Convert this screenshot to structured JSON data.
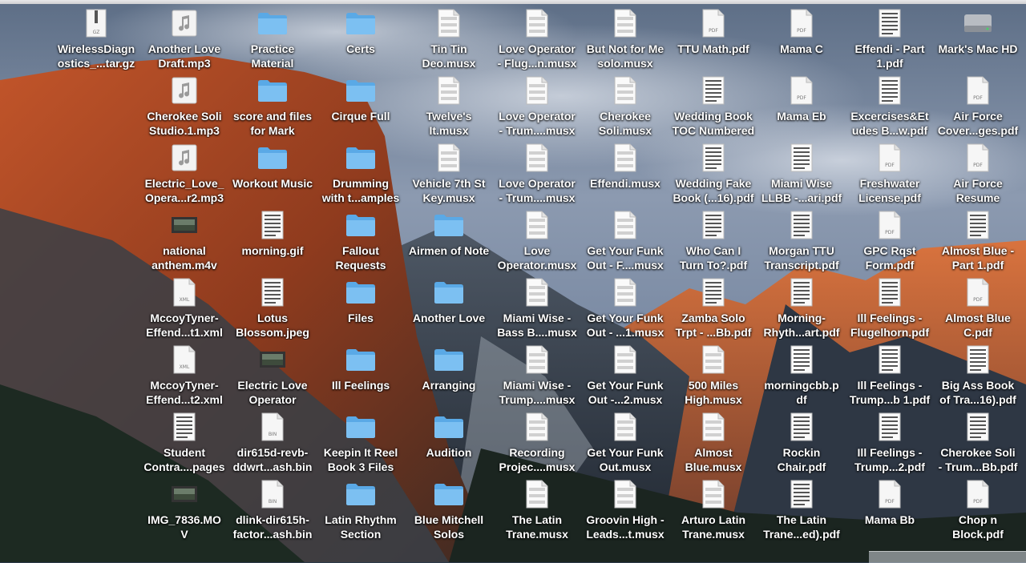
{
  "columns": [
    [
      {
        "name": "WirelessDiagn\nostics_...tar.gz",
        "icon": "archive-icon",
        "kind": "archive",
        "badge": "GZ"
      },
      {
        "name": "",
        "icon": "none",
        "kind": "blank"
      },
      {
        "name": "",
        "icon": "none",
        "kind": "blank"
      },
      {
        "name": "",
        "icon": "none",
        "kind": "blank"
      },
      {
        "name": "",
        "icon": "none",
        "kind": "blank"
      },
      {
        "name": "",
        "icon": "none",
        "kind": "blank"
      },
      {
        "name": "",
        "icon": "none",
        "kind": "blank"
      },
      {
        "name": "",
        "icon": "none",
        "kind": "blank"
      }
    ],
    [
      {
        "name": "Another Love\nDraft.mp3",
        "icon": "audio-file-icon",
        "kind": "audio"
      },
      {
        "name": "Cherokee Soli\nStudio.1.mp3",
        "icon": "audio-file-icon",
        "kind": "audio"
      },
      {
        "name": "Electric_Love_\nOpera...r2.mp3",
        "icon": "audio-file-icon",
        "kind": "audio"
      },
      {
        "name": "national\nanthem.m4v",
        "icon": "video-file-icon",
        "kind": "video"
      },
      {
        "name": "McсoyTyner-\nEffend...t1.xml",
        "icon": "xml-file-icon",
        "kind": "doc",
        "badge": "XML"
      },
      {
        "name": "MccoyTyner-\nEffend...t2.xml",
        "icon": "xml-file-icon",
        "kind": "doc",
        "badge": "XML"
      },
      {
        "name": "Student\nContra....pages",
        "icon": "pages-document-icon",
        "kind": "sheet"
      },
      {
        "name": "IMG_7836.MO\nV",
        "icon": "video-file-icon",
        "kind": "video"
      }
    ],
    [
      {
        "name": "Practice\nMaterial",
        "icon": "folder-icon",
        "kind": "folder"
      },
      {
        "name": "score and files\nfor Mark",
        "icon": "folder-icon",
        "kind": "folder"
      },
      {
        "name": "Workout Music",
        "icon": "folder-icon",
        "kind": "folder"
      },
      {
        "name": "morning.gif",
        "icon": "image-file-icon",
        "kind": "sheet"
      },
      {
        "name": "Lotus\nBlossom.jpeg",
        "icon": "image-file-icon",
        "kind": "sheet"
      },
      {
        "name": "Electric Love\nOperator",
        "icon": "application-icon",
        "kind": "video"
      },
      {
        "name": "dir615d-revb-\nddwrt...ash.bin",
        "icon": "binary-file-icon",
        "kind": "doc",
        "badge": "BIN"
      },
      {
        "name": "dlink-dir615h-\nfactor...ash.bin",
        "icon": "binary-file-icon",
        "kind": "doc",
        "badge": "BIN"
      }
    ],
    [
      {
        "name": "Certs",
        "icon": "folder-icon",
        "kind": "folder"
      },
      {
        "name": "Cirque Full",
        "icon": "folder-icon",
        "kind": "folder"
      },
      {
        "name": "Drumming\nwith t...amples",
        "icon": "folder-icon",
        "kind": "folder"
      },
      {
        "name": "Fallout\nRequests",
        "icon": "folder-icon",
        "kind": "folder"
      },
      {
        "name": "Files",
        "icon": "folder-icon",
        "kind": "folder"
      },
      {
        "name": "Ill Feelings",
        "icon": "folder-icon",
        "kind": "folder"
      },
      {
        "name": "Keepin It Reel\nBook 3 Files",
        "icon": "folder-icon",
        "kind": "folder"
      },
      {
        "name": "Latin Rhythm\nSection",
        "icon": "folder-icon",
        "kind": "folder"
      }
    ],
    [
      {
        "name": "Tin Tin\nDeo.musx",
        "icon": "music-score-icon",
        "kind": "score"
      },
      {
        "name": "Twelve's\nIt.musx",
        "icon": "music-score-icon",
        "kind": "score"
      },
      {
        "name": "Vehicle 7th St\nKey.musx",
        "icon": "music-score-icon",
        "kind": "score"
      },
      {
        "name": "Airmen of Note",
        "icon": "folder-icon",
        "kind": "folder"
      },
      {
        "name": "Another Love",
        "icon": "folder-icon",
        "kind": "folder"
      },
      {
        "name": "Arranging",
        "icon": "folder-icon",
        "kind": "folder"
      },
      {
        "name": "Audition",
        "icon": "folder-icon",
        "kind": "folder"
      },
      {
        "name": "Blue Mitchell\nSolos",
        "icon": "folder-icon",
        "kind": "folder"
      }
    ],
    [
      {
        "name": "Love Operator\n- Flug...n.musx",
        "icon": "music-score-icon",
        "kind": "score"
      },
      {
        "name": "Love Operator\n- Trum....musx",
        "icon": "music-score-icon",
        "kind": "score"
      },
      {
        "name": "Love Operator\n- Trum....musx",
        "icon": "music-score-icon",
        "kind": "score"
      },
      {
        "name": "Love\nOperator.musx",
        "icon": "music-score-icon",
        "kind": "score"
      },
      {
        "name": "Miami Wise -\nBass B....musx",
        "icon": "music-score-icon",
        "kind": "score"
      },
      {
        "name": "Miami Wise -\nTrump....musx",
        "icon": "music-score-icon",
        "kind": "score"
      },
      {
        "name": "Recording\nProjec....musx",
        "icon": "music-score-icon",
        "kind": "score"
      },
      {
        "name": "The Latin\nTrane.musx",
        "icon": "music-score-icon",
        "kind": "score"
      }
    ],
    [
      {
        "name": "But Not for Me\nsolo.musx",
        "icon": "music-score-icon",
        "kind": "score"
      },
      {
        "name": "Cherokee\nSoli.musx",
        "icon": "music-score-icon",
        "kind": "score"
      },
      {
        "name": "Effendi.musx",
        "icon": "music-score-icon",
        "kind": "score"
      },
      {
        "name": "Get Your Funk\nOut - F....musx",
        "icon": "music-score-icon",
        "kind": "score"
      },
      {
        "name": "Get Your Funk\nOut - ...1.musx",
        "icon": "music-score-icon",
        "kind": "score"
      },
      {
        "name": "Get Your Funk\nOut -...2.musx",
        "icon": "music-score-icon",
        "kind": "score"
      },
      {
        "name": "Get Your Funk\nOut.musx",
        "icon": "music-score-icon",
        "kind": "score"
      },
      {
        "name": "Groovin High -\nLeads...t.musx",
        "icon": "music-score-icon",
        "kind": "score"
      }
    ],
    [
      {
        "name": "TTU Math.pdf",
        "icon": "pdf-file-icon",
        "kind": "pdf",
        "badge": "PDF"
      },
      {
        "name": "Wedding Book\nTOC Numbered",
        "icon": "document-icon",
        "kind": "sheet"
      },
      {
        "name": "Wedding Fake\nBook (...16).pdf",
        "icon": "pdf-file-icon",
        "kind": "sheet"
      },
      {
        "name": "Who Can I\nTurn To?.pdf",
        "icon": "pdf-file-icon",
        "kind": "sheet"
      },
      {
        "name": "Zamba Solo\nTrpt - ...Bb.pdf",
        "icon": "pdf-file-icon",
        "kind": "sheet"
      },
      {
        "name": "500 Miles\nHigh.musx",
        "icon": "music-score-icon",
        "kind": "score"
      },
      {
        "name": "Almost\nBlue.musx",
        "icon": "music-score-icon",
        "kind": "score"
      },
      {
        "name": "Arturo Latin\nTrane.musx",
        "icon": "music-score-icon",
        "kind": "score"
      }
    ],
    [
      {
        "name": "Mama C",
        "icon": "pdf-file-icon",
        "kind": "pdf",
        "badge": "PDF"
      },
      {
        "name": "Mama Eb",
        "icon": "pdf-file-icon",
        "kind": "pdf",
        "badge": "PDF"
      },
      {
        "name": "Miami Wise\nLLBB -...ari.pdf",
        "icon": "pdf-file-icon",
        "kind": "sheet"
      },
      {
        "name": "Morgan TTU\nTranscript.pdf",
        "icon": "pdf-file-icon",
        "kind": "sheet"
      },
      {
        "name": "Morning-\nRhyth...art.pdf",
        "icon": "pdf-file-icon",
        "kind": "sheet"
      },
      {
        "name": "morningcbb.p\ndf",
        "icon": "pdf-file-icon",
        "kind": "sheet"
      },
      {
        "name": "Rockin\nChair.pdf",
        "icon": "pdf-file-icon",
        "kind": "sheet"
      },
      {
        "name": "The Latin\nTrane...ed).pdf",
        "icon": "pdf-file-icon",
        "kind": "sheet"
      }
    ],
    [
      {
        "name": "Effendi - Part\n1.pdf",
        "icon": "pdf-file-icon",
        "kind": "sheet"
      },
      {
        "name": "Excercises&Et\nudes B...w.pdf",
        "icon": "pdf-file-icon",
        "kind": "sheet"
      },
      {
        "name": "Freshwater\nLicense.pdf",
        "icon": "pdf-file-icon",
        "kind": "pdf",
        "badge": "PDF"
      },
      {
        "name": "GPC Rqst\nForm.pdf",
        "icon": "pdf-file-icon",
        "kind": "pdf",
        "badge": "PDF"
      },
      {
        "name": "Ill Feelings -\nFlugelhorn.pdf",
        "icon": "pdf-file-icon",
        "kind": "sheet"
      },
      {
        "name": "Ill Feelings -\nTrump...b 1.pdf",
        "icon": "pdf-file-icon",
        "kind": "sheet"
      },
      {
        "name": "Ill Feelings -\nTrump...2.pdf",
        "icon": "pdf-file-icon",
        "kind": "sheet"
      },
      {
        "name": "Mama Bb",
        "icon": "pdf-file-icon",
        "kind": "pdf",
        "badge": "PDF"
      }
    ],
    [
      {
        "name": "Mark's Mac HD",
        "icon": "hard-drive-icon",
        "kind": "drive"
      },
      {
        "name": "Air Force\nCover...ges.pdf",
        "icon": "pdf-file-icon",
        "kind": "pdf",
        "badge": "PDF"
      },
      {
        "name": "Air Force\nResume",
        "icon": "pdf-file-icon",
        "kind": "pdf",
        "badge": "PDF"
      },
      {
        "name": "Almost Blue -\nPart 1.pdf",
        "icon": "pdf-file-icon",
        "kind": "sheet"
      },
      {
        "name": "Almost Blue\nC.pdf",
        "icon": "pdf-file-icon",
        "kind": "pdf",
        "badge": "PDF"
      },
      {
        "name": "Big Ass Book\nof Tra...16).pdf",
        "icon": "pdf-file-icon",
        "kind": "sheet"
      },
      {
        "name": "Cherokee Soli\n- Trum...Bb.pdf",
        "icon": "pdf-file-icon",
        "kind": "sheet"
      },
      {
        "name": "Chop n\nBlock.pdf",
        "icon": "pdf-file-icon",
        "kind": "pdf",
        "badge": "PDF"
      }
    ]
  ]
}
